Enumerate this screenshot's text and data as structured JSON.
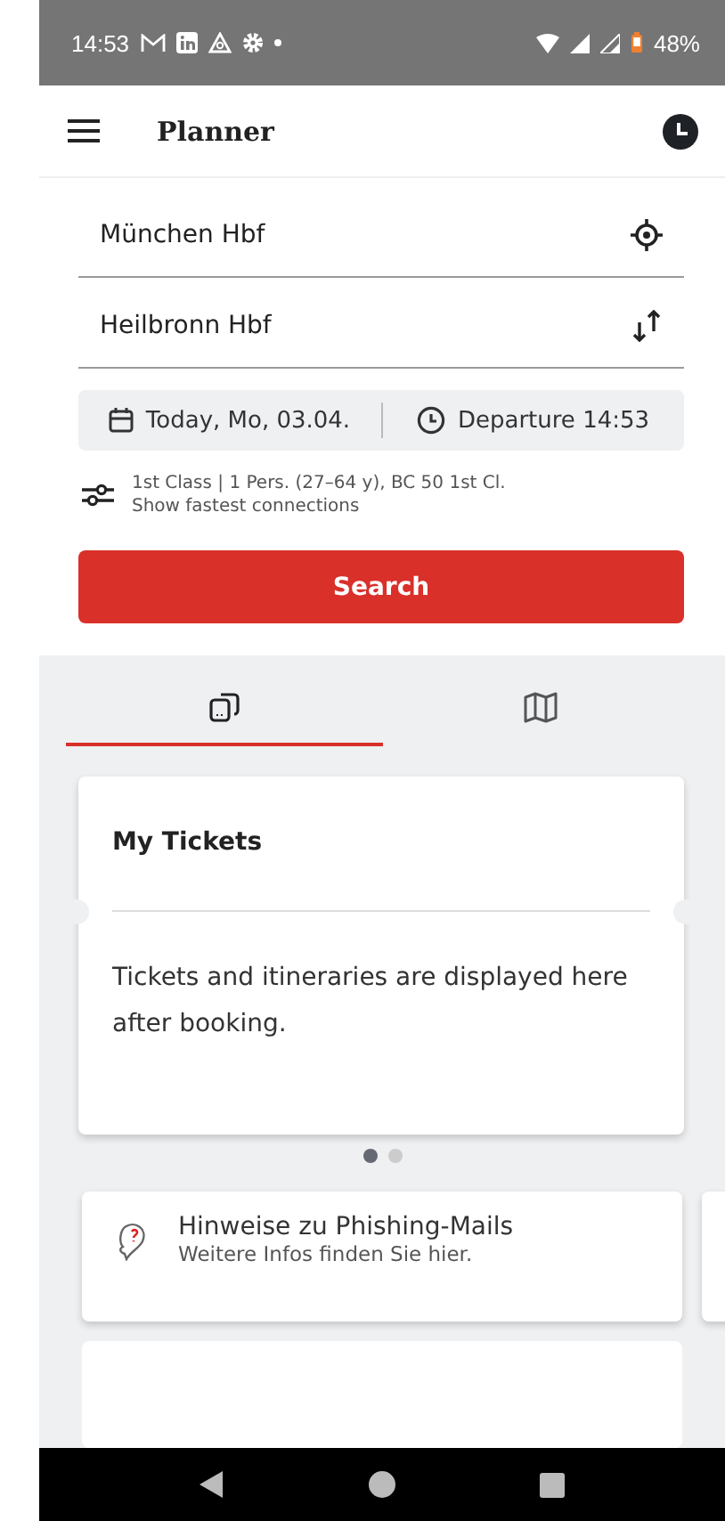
{
  "status_bar": {
    "time": "14:53",
    "battery": "48%"
  },
  "app_bar": {
    "title": "Planner"
  },
  "search": {
    "from": "München Hbf",
    "to": "Heilbronn Hbf",
    "date": "Today, Mo, 03.04.",
    "time": "Departure 14:53",
    "options": [
      "1st Class | 1 Pers. (27–64 y), BC 50 1st Cl.",
      "Show fastest connections"
    ],
    "button": "Search"
  },
  "tabs": [
    {
      "kind": "tickets",
      "selected": true
    },
    {
      "kind": "map",
      "selected": false
    }
  ],
  "ticket_card": {
    "title": "My Tickets",
    "text": "Tickets and itineraries are displayed here after booking."
  },
  "pager": [
    {
      "selected": true
    },
    {
      "selected": false
    }
  ],
  "info_cards": [
    {
      "title": "Hinweise zu Phishing-Mails",
      "subtitle": "Weitere Infos finden Sie hier."
    }
  ]
}
